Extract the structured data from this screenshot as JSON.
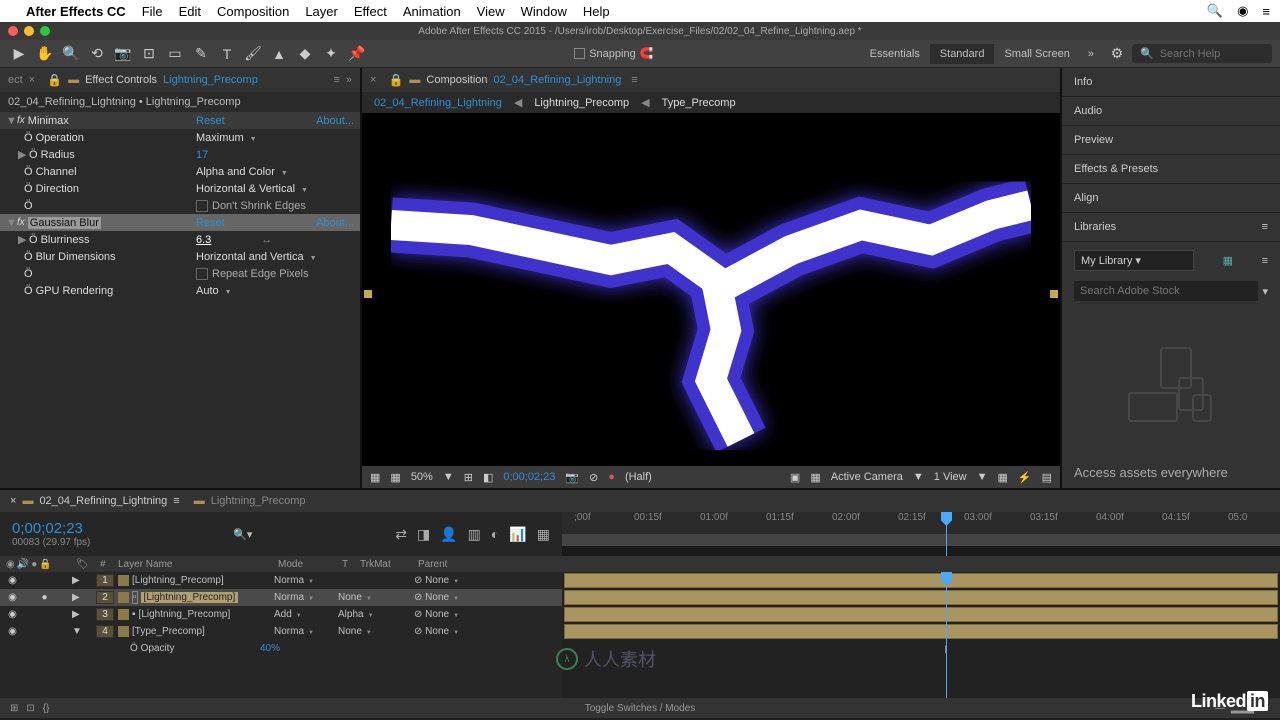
{
  "mac_menu": {
    "apple": "",
    "app": "After Effects CC",
    "items": [
      "File",
      "Edit",
      "Composition",
      "Layer",
      "Effect",
      "Animation",
      "View",
      "Window",
      "Help"
    ]
  },
  "window_title": "Adobe After Effects CC 2015 - /Users/irob/Desktop/Exercise_Files/02/02_04_Refine_Lightning.aep *",
  "toolbar": {
    "snapping": "Snapping",
    "workspaces": [
      "Essentials",
      "Standard",
      "Small Screen"
    ],
    "search_placeholder": "Search Help"
  },
  "ec_panel": {
    "tab": "Effect Controls",
    "layer": "Lightning_Precomp",
    "path": "02_04_Refining_Lightning • Lightning_Precomp",
    "reset": "Reset",
    "about": "About...",
    "minimax": {
      "name": "Minimax",
      "operation_lbl": "Operation",
      "operation": "Maximum",
      "radius_lbl": "Radius",
      "radius": "17",
      "channel_lbl": "Channel",
      "channel": "Alpha and Color",
      "direction_lbl": "Direction",
      "direction": "Horizontal & Vertical",
      "shrink": "Don't Shrink Edges"
    },
    "gauss": {
      "name": "Gaussian Blur",
      "blurriness_lbl": "Blurriness",
      "blurriness": "6.3",
      "dims_lbl": "Blur Dimensions",
      "dims": "Horizontal and Vertica",
      "repeat": "Repeat Edge Pixels",
      "gpu_lbl": "GPU Rendering",
      "gpu": "Auto"
    }
  },
  "comp_panel": {
    "tab": "Composition",
    "name": "02_04_Refining_Lightning",
    "crumbs": [
      "02_04_Refining_Lightning",
      "Lightning_Precomp",
      "Type_Precomp"
    ],
    "footer": {
      "zoom": "50%",
      "time": "0;00;02;23",
      "res": "(Half)",
      "camera": "Active Camera",
      "views": "1 View"
    }
  },
  "right": {
    "items": [
      "Info",
      "Audio",
      "Preview",
      "Effects & Presets",
      "Align"
    ],
    "libraries": "Libraries",
    "mylibrary": "My Library",
    "stock_placeholder": "Search Adobe Stock",
    "assets_text": "Access assets everywhere"
  },
  "timeline": {
    "tab1": "02_04_Refining_Lightning",
    "tab2": "Lightning_Precomp",
    "time": "0;00;02;23",
    "fps": "00083 (29.97 fps)",
    "cols": {
      "layer": "Layer Name",
      "mode": "Mode",
      "t": "T",
      "trk": "TrkMat",
      "parent": "Parent"
    },
    "ruler": [
      ";00f",
      "00:15f",
      "01:00f",
      "01:15f",
      "02:00f",
      "02:15f",
      "03:00f",
      "03:15f",
      "04:00f",
      "04:15f",
      "05:0"
    ],
    "layers": [
      {
        "n": "1",
        "name": "[Lightning_Precomp]",
        "mode": "Norma",
        "trk": "",
        "parent": "None",
        "sel": false
      },
      {
        "n": "2",
        "name": "[Lightning_Precomp]",
        "mode": "Norma",
        "trk": "None",
        "parent": "None",
        "sel": true
      },
      {
        "n": "3",
        "name": "[Lightning_Precomp]",
        "mode": "Add",
        "trk": "Alpha",
        "parent": "None",
        "sel": false
      },
      {
        "n": "4",
        "name": "[Type_Precomp]",
        "mode": "Norma",
        "trk": "None",
        "parent": "None",
        "sel": false
      }
    ],
    "opacity_lbl": "Opacity",
    "opacity": "40%",
    "footer": "Toggle Switches / Modes"
  },
  "linkedin": "Linked",
  "watermark": "人人素材"
}
